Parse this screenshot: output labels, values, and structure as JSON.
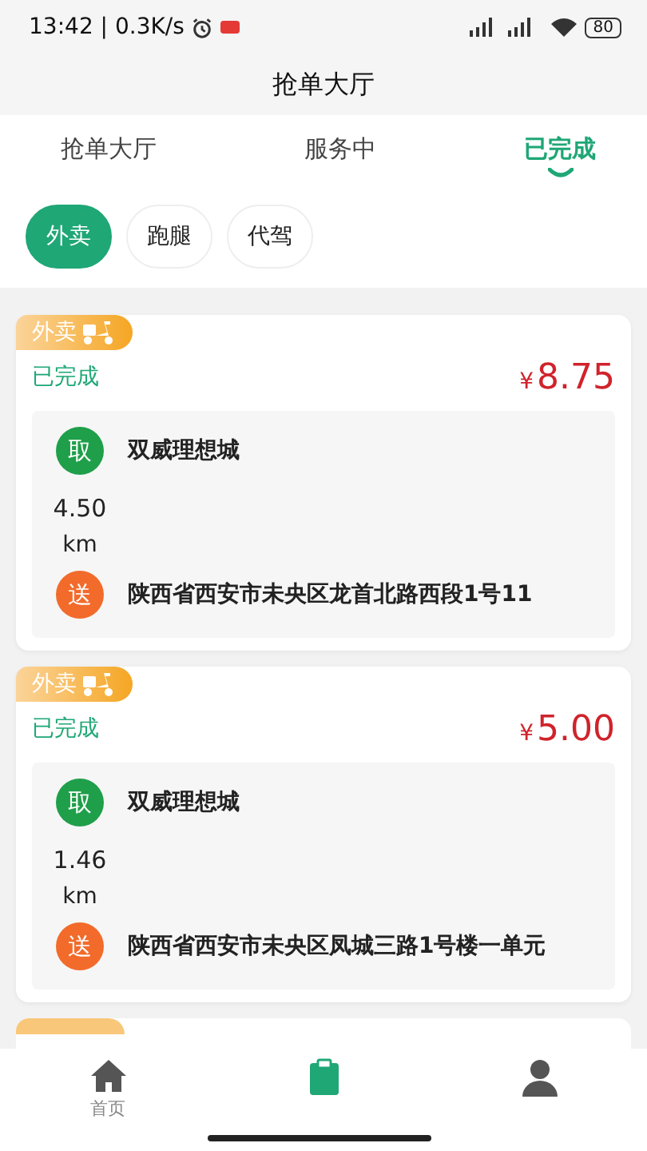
{
  "status_bar": {
    "time": "13:42 | 0.3K/s",
    "battery": "80"
  },
  "header": {
    "title": "抢单大厅"
  },
  "tabs": [
    {
      "label": "抢单大厅",
      "selected": false
    },
    {
      "label": "服务中",
      "selected": false
    },
    {
      "label": "已完成",
      "selected": true
    }
  ],
  "chips": [
    {
      "label": "外卖",
      "selected": true
    },
    {
      "label": "跑腿",
      "selected": false
    },
    {
      "label": "代驾",
      "selected": false
    }
  ],
  "orders": [
    {
      "type": "外卖",
      "status": "已完成",
      "currency": "¥",
      "price": "8.75",
      "pickup_mark": "取",
      "pickup": "双威理想城",
      "distance": "4.50",
      "unit": "km",
      "drop_mark": "送",
      "dropoff": "陕西省西安市未央区龙首北路西段1号11"
    },
    {
      "type": "外卖",
      "status": "已完成",
      "currency": "¥",
      "price": "5.00",
      "pickup_mark": "取",
      "pickup": "双威理想城",
      "distance": "1.46",
      "unit": "km",
      "drop_mark": "送",
      "dropoff": "陕西省西安市未央区凤城三路1号楼一单元"
    }
  ],
  "bottom_nav": [
    {
      "kind": "home",
      "label": "首页",
      "selected": false
    },
    {
      "kind": "clipboard",
      "selected": true
    },
    {
      "kind": "person",
      "selected": false
    }
  ]
}
